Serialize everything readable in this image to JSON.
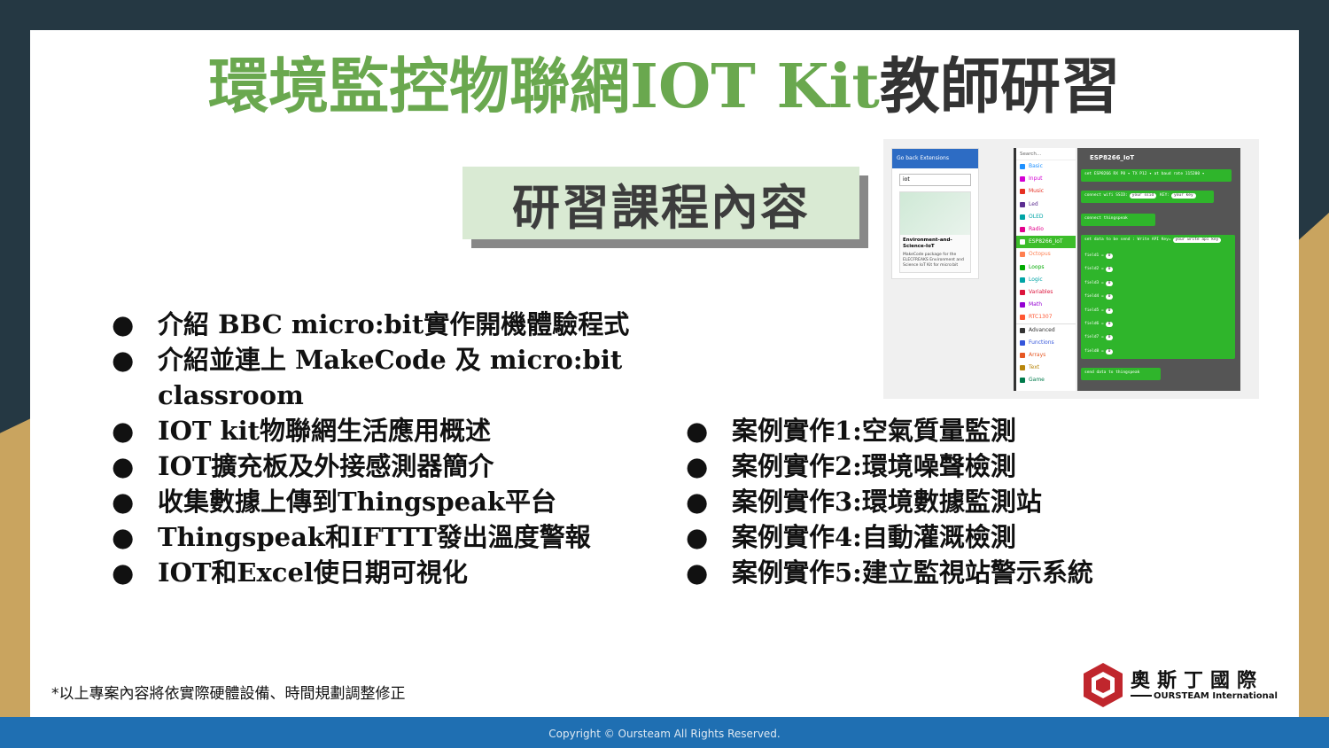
{
  "title": {
    "green_part": "環境監控物聯網IOT Kit",
    "dark_part": "教師研習"
  },
  "subtitle": "研習課程內容",
  "bullet_symbol": "●",
  "left_list": [
    "介紹 BBC micro:bit實作開機體驗程式",
    "介紹並連上 MakeCode 及 micro:bit classroom",
    "IOT kit物聯網生活應用概述",
    "IOT擴充板及外接感測器簡介",
    "收集數據上傳到Thingspeak平台",
    "Thingspeak和IFTTT發出溫度警報",
    "IOT和Excel使日期可視化"
  ],
  "right_list": [
    "案例實作1:空氣質量監測",
    "案例實作2:環境噪聲檢測",
    "案例實作3:環境數據監測站",
    "案例實作4:自動灌溉檢測",
    "案例實作5:建立監視站警示系統"
  ],
  "footnote": "*以上專案內容將依實際硬體設備、時間規劃調整修正",
  "logo": {
    "cn": "奧斯丁國際",
    "en": "OURSTEAM International"
  },
  "footer": "Copyright © Oursteam All Rights Reserved.",
  "screenshot": {
    "ext_header": "Go back   Extensions",
    "ext_search": "iot",
    "card_name": "Environment-and-Science-IoT",
    "card_desc": "MakeCode package for the ELECFREAKS Environment and Science IoT Kit for micro:bit",
    "toolbox_search": "Search...",
    "toolbox": [
      {
        "label": "Basic",
        "color": "#1e90ff"
      },
      {
        "label": "Input",
        "color": "#d400d4"
      },
      {
        "label": "Music",
        "color": "#e63022"
      },
      {
        "label": "Led",
        "color": "#5c2d91"
      },
      {
        "label": "OLED",
        "color": "#00a4a6"
      },
      {
        "label": "Radio",
        "color": "#e3008c"
      },
      {
        "label": "ESP8266_IoT",
        "color": "#3cbd2a"
      },
      {
        "label": "Octopus",
        "color": "#ff7f50"
      },
      {
        "label": "Loops",
        "color": "#00aa00"
      },
      {
        "label": "Logic",
        "color": "#00a4a6"
      },
      {
        "label": "Variables",
        "color": "#dc143c"
      },
      {
        "label": "Math",
        "color": "#9400d3"
      },
      {
        "label": "RTC1307",
        "color": "#ff5733"
      },
      {
        "label": "Advanced",
        "color": "#333333"
      },
      {
        "label": "Functions",
        "color": "#3455db"
      },
      {
        "label": "Arrays",
        "color": "#e65722"
      },
      {
        "label": "Text",
        "color": "#b8860b"
      },
      {
        "label": "Game",
        "color": "#007a4b"
      }
    ],
    "workspace_title": "ESP8266_IoT",
    "blocks": [
      "set ESP8266 RX P8 ▾ TX P12 ▾ at baud rate 115200 ▾",
      "connect wifi SSID:",
      "connect thingspeak",
      "set data to be send : Write API Key=",
      "field1 =",
      "field2 =",
      "field3 =",
      "field4 =",
      "field5 =",
      "field6 =",
      "field7 =",
      "field8 =",
      "send data to thingspeak"
    ],
    "pills": {
      "ssid": "your ssid",
      "key_label": "KEY:",
      "key": "your key",
      "api": "your write api key",
      "zero": "0"
    }
  }
}
